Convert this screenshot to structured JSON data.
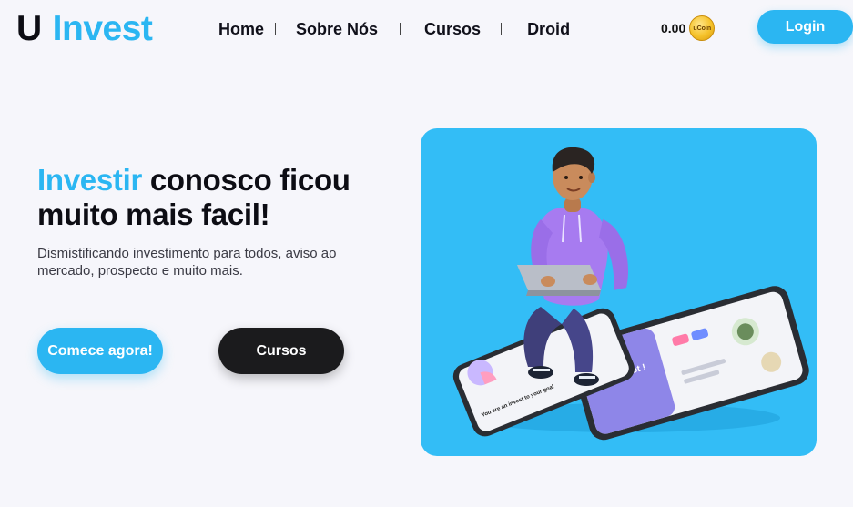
{
  "brand": {
    "u": "U",
    "name": "Invest"
  },
  "nav": {
    "items": [
      {
        "label": "Home"
      },
      {
        "label": "Sobre Nós"
      },
      {
        "label": "Cursos"
      },
      {
        "label": "Droid"
      }
    ]
  },
  "wallet": {
    "balance": "0.00",
    "coin_label": "uCoin"
  },
  "header": {
    "login_label": "Login"
  },
  "hero": {
    "headline_accent": "Investir",
    "headline_rest": " conosco ficou muito mais facil!",
    "subtext": "Dismistificando investimento para todos, aviso ao mercado, prospecto e muito mais.",
    "cta_primary": "Comece agora!",
    "cta_secondary": "Cursos",
    "illustration": {
      "phone_front_text": "You are an invest to your goal",
      "phone_back_text": "Hello Elliot !"
    }
  },
  "colors": {
    "accent": "#2bb6f2",
    "dark": "#1b1b1d",
    "background": "#f6f6fb",
    "hero_card": "#33bdf6"
  }
}
